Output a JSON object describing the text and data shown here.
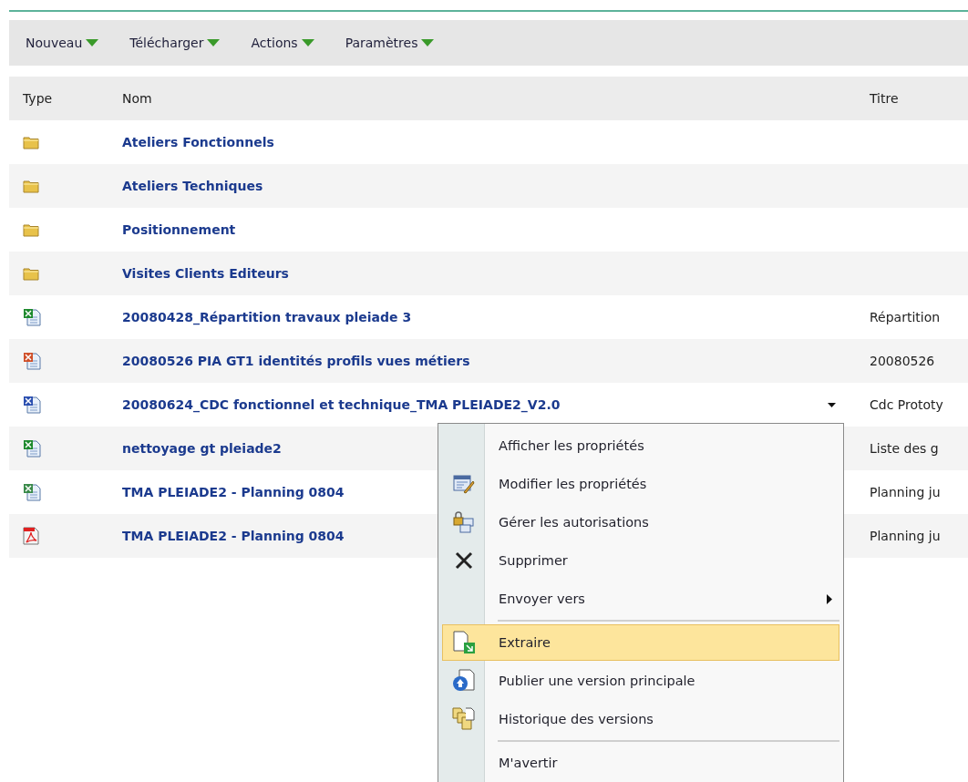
{
  "toolbar": [
    {
      "label": "Nouveau"
    },
    {
      "label": "Télécharger"
    },
    {
      "label": "Actions"
    },
    {
      "label": "Paramètres"
    }
  ],
  "columns": [
    "Type",
    "Nom",
    "Titre"
  ],
  "rows": [
    {
      "kind": "folder",
      "name": "Ateliers Fonctionnels",
      "menu_open": false
    },
    {
      "kind": "folder",
      "name": "Ateliers Techniques",
      "menu_open": false
    },
    {
      "kind": "folder",
      "name": "Positionnement",
      "menu_open": false
    },
    {
      "kind": "folder",
      "name": "Visites Clients Editeurs",
      "menu_open": false
    },
    {
      "kind": "excel",
      "name": "20080428_Répartition travaux pleiade 3",
      "title": "Répartition",
      "menu_open": false
    },
    {
      "kind": "powerpoint",
      "name": "20080526 PIA GT1 identités profils vues métiers",
      "title": "20080526",
      "menu_open": false
    },
    {
      "kind": "word",
      "name": "20080624_CDC fonctionnel et technique_TMA PLEIADE2_V2.0",
      "title": "Cdc Prototy",
      "menu_open": true
    },
    {
      "kind": "excel",
      "name": "nettoyage gt pleiade2",
      "title": "Liste des g",
      "menu_open": false
    },
    {
      "kind": "project",
      "name": "TMA PLEIADE2 - Planning 0804",
      "title": "Planning ju",
      "menu_open": false
    },
    {
      "kind": "pdf",
      "name": "TMA PLEIADE2 - Planning 0804",
      "title": "Planning ju",
      "menu_open": false
    }
  ],
  "context_menu": [
    {
      "label": "Afficher les propriétés",
      "kind": "none",
      "selected": false,
      "submenu": false,
      "separator_before": false
    },
    {
      "label": "Modifier les propriétés",
      "kind": "edit",
      "selected": false,
      "submenu": false,
      "separator_before": false
    },
    {
      "label": "Gérer les autorisations",
      "kind": "permissions",
      "selected": false,
      "submenu": false,
      "separator_before": false
    },
    {
      "label": "Supprimer",
      "kind": "delete",
      "selected": false,
      "submenu": false,
      "separator_before": false
    },
    {
      "label": "Envoyer vers",
      "kind": "none",
      "selected": false,
      "submenu": true,
      "separator_before": false
    },
    {
      "label": "Extraire",
      "kind": "checkout",
      "selected": true,
      "submenu": false,
      "separator_before": true
    },
    {
      "label": "Publier une version principale",
      "kind": "publish",
      "selected": false,
      "submenu": false,
      "separator_before": false
    },
    {
      "label": "Historique des versions",
      "kind": "history",
      "selected": false,
      "submenu": false,
      "separator_before": false
    },
    {
      "label": "M'avertir",
      "kind": "none",
      "selected": false,
      "submenu": false,
      "separator_before": true
    }
  ]
}
